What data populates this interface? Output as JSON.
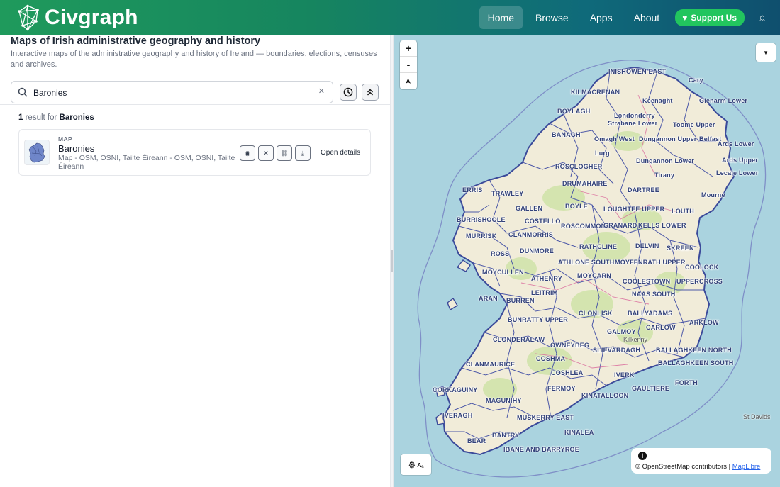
{
  "header": {
    "brand": "Civgraph",
    "nav": [
      "Home",
      "Browse",
      "Apps",
      "About"
    ],
    "support_label": "Support Us",
    "theme_icon": "sun-icon",
    "colors": {
      "gradient_start": "#1f9a5c",
      "gradient_end": "#0f4f6e",
      "support": "#22c55e"
    }
  },
  "page": {
    "title": "Maps of Irish administrative geography and history",
    "description": "Interactive maps of the administrative geography and history of Ireland — boundaries, elections, censuses and archives."
  },
  "search": {
    "value": "Baronies",
    "clear_glyph": "✕"
  },
  "results": {
    "count": "1",
    "mid_text": " result for ",
    "query": "Baronies",
    "items": [
      {
        "type": "MAP",
        "title": "Baronies",
        "subtitle": "Map - OSM, OSNI, Tailte Éireann - OSM, OSNI, Tailte Éireann",
        "open_label": "Open details"
      }
    ]
  },
  "map": {
    "zoom_in": "+",
    "zoom_out": "-",
    "compass": "➤",
    "dropdown": "▼",
    "style_label": "Aₐ",
    "info": "i",
    "attribution_prefix": "© OpenStreetMap contributors | ",
    "attribution_link": "MapLibre",
    "barony_labels": [
      "INISHOWEN EAST",
      "KILMACRENAN",
      "Cary",
      "Glenarm Lower",
      "Keenaght",
      "BOYLAGH",
      "Londonderry",
      "Strabane Lower",
      "Toome Upper",
      "BANAGH",
      "Omagh West",
      "Dungannon Upper",
      "Belfast",
      "Ards Lower",
      "Lurg",
      "Dungannon Lower",
      "Ards Upper",
      "Tirany",
      "Lecale Lower",
      "ROSCLOGHER",
      "DRUMAHAIRE",
      "DARTREE",
      "Mourne",
      "ERRIS",
      "TRAWLEY",
      "BOYLE",
      "LOUGHTEE UPPER",
      "LOUTH",
      "GALLEN",
      "COSTELLO",
      "BURRISHOOLE",
      "ROSCOMMON",
      "GRANARD",
      "KELLS LOWER",
      "MURRISK",
      "CLANMORRIS",
      "DELVIN",
      "SKREEN",
      "DUNMORE",
      "RATHCLINE",
      "ROSS",
      "ATHLONE SOUTH",
      "MOYFENRATH UPPER",
      "COOLOCK",
      "MOYCULLEN",
      "MOYCARN",
      "COOLESTOWN",
      "UPPERCROSS",
      "ATHENRY",
      "LEITRIM",
      "NAAS SOUTH",
      "ARAN",
      "BURREN",
      "CLONLISK",
      "BALLYADAMS",
      "ARKLOW",
      "BUNRATTY UPPER",
      "CARLOW",
      "GALMOY",
      "CLONDERALAW",
      "OWNEYBEG",
      "SLIEVARDAGH",
      "BALLAGHKEEN NORTH",
      "BALLAGHKEEN SOUTH",
      "COSHMA",
      "CLANMAURICE",
      "COSHLEA",
      "IVERK",
      "FORTH",
      "GAULTIERE",
      "CORKAGUINY",
      "FERMOY",
      "KINATALLOON",
      "MAGUNIHY",
      "IVERAGH",
      "MUSKERRY EAST",
      "BANTRY",
      "KINALEA",
      "BEAR",
      "IBANE AND BARRYROE",
      "St Davids"
    ],
    "towns": [
      "Kilkenny",
      "Kilkenny"
    ]
  }
}
